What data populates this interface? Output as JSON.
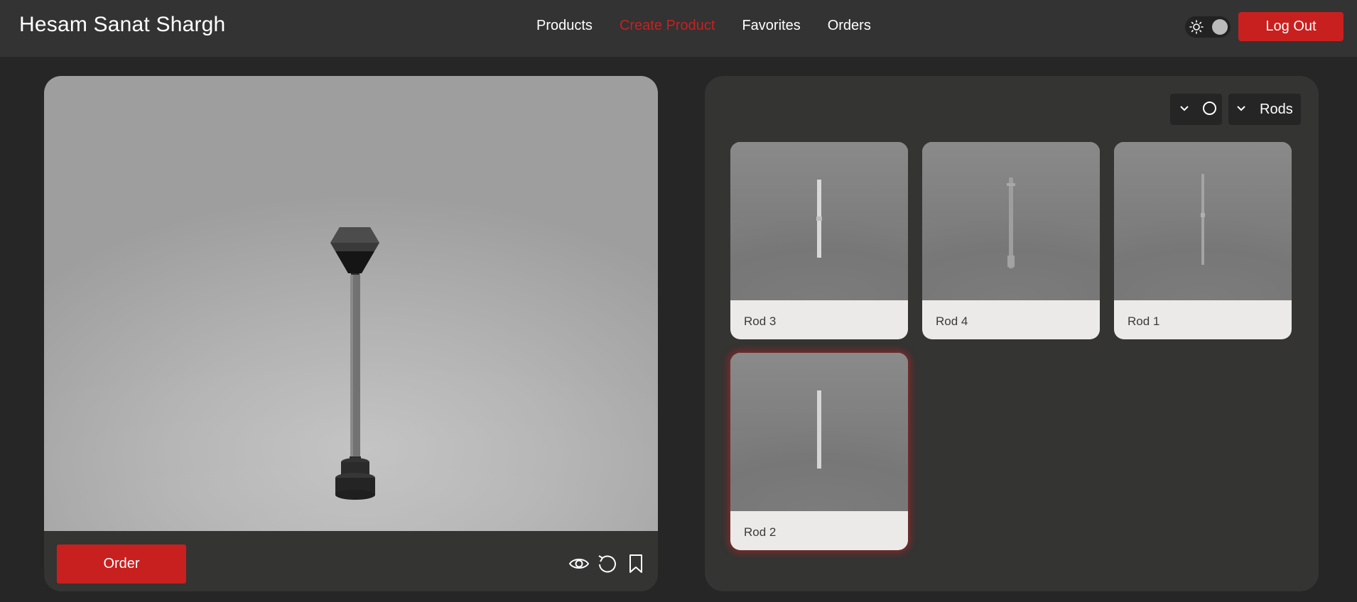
{
  "header": {
    "brand": "Hesam Sanat Shargh",
    "nav": [
      {
        "label": "Products",
        "active": false
      },
      {
        "label": "Create Product",
        "active": true
      },
      {
        "label": "Favorites",
        "active": false
      },
      {
        "label": "Orders",
        "active": false
      }
    ],
    "theme_toggle_icon": "sun-icon",
    "logout_label": "Log Out"
  },
  "viewer": {
    "order_label": "Order",
    "tool_icons": [
      "eye-icon",
      "reset-icon",
      "bookmark-icon"
    ]
  },
  "filters": {
    "shape_icon": "circle-icon",
    "category": "Rods"
  },
  "products": [
    {
      "label": "Rod 3",
      "selected": false
    },
    {
      "label": "Rod 4",
      "selected": false
    },
    {
      "label": "Rod 1",
      "selected": false
    },
    {
      "label": "Rod 2",
      "selected": true
    }
  ],
  "colors": {
    "accent": "#c8201f",
    "background": "#262626",
    "surface": "#343433"
  }
}
